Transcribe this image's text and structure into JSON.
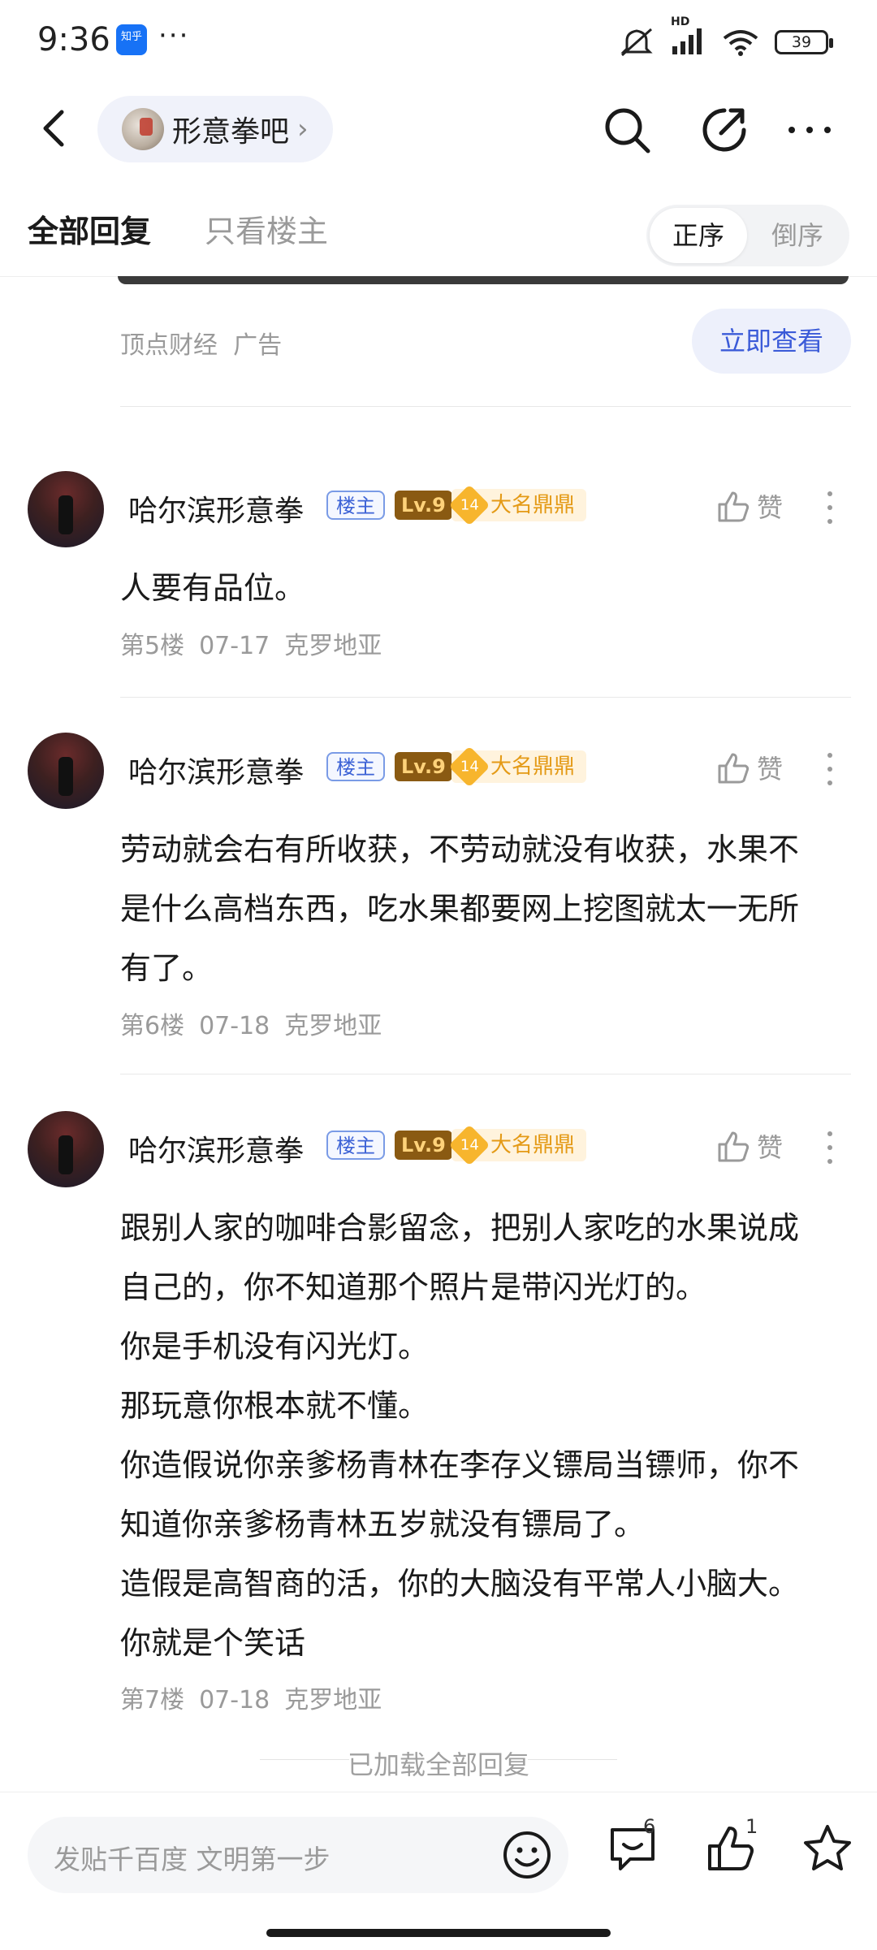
{
  "status": {
    "time": "9:36",
    "app_badge": "知乎",
    "more": "···",
    "network": "HD",
    "battery": "39"
  },
  "nav": {
    "forum_name": "形意拳吧"
  },
  "tabs": {
    "all": "全部回复",
    "host_only": "只看楼主",
    "sort_asc": "正序",
    "sort_desc": "倒序"
  },
  "ad": {
    "source": "顶点财经  广告",
    "cta": "立即查看"
  },
  "posts": [
    {
      "username": "哈尔滨形意拳",
      "host_tag": "楼主",
      "level": "Lv.9",
      "title_level": "14",
      "title": "大名鼎鼎",
      "like_label": "赞",
      "lines": [
        "人要有品位。"
      ],
      "floor": "第5楼",
      "date": "07-17",
      "location": "克罗地亚"
    },
    {
      "username": "哈尔滨形意拳",
      "host_tag": "楼主",
      "level": "Lv.9",
      "title_level": "14",
      "title": "大名鼎鼎",
      "like_label": "赞",
      "lines": [
        "劳动就会右有所收获，不劳动就没有收获，水果不",
        "是什么高档东西，吃水果都要网上挖图就太一无所",
        "有了。"
      ],
      "floor": "第6楼",
      "date": "07-18",
      "location": "克罗地亚"
    },
    {
      "username": "哈尔滨形意拳",
      "host_tag": "楼主",
      "level": "Lv.9",
      "title_level": "14",
      "title": "大名鼎鼎",
      "like_label": "赞",
      "lines": [
        "跟别人家的咖啡合影留念，把别人家吃的水果说成",
        "自己的，你不知道那个照片是带闪光灯的。",
        "你是手机没有闪光灯。",
        "那玩意你根本就不懂。",
        "你造假说你亲爹杨青林在李存义镖局当镖师，你不",
        "知道你亲爹杨青林五岁就没有镖局了。",
        "造假是高智商的活，你的大脑没有平常人小脑大。",
        "你就是个笑话"
      ],
      "floor": "第7楼",
      "date": "07-18",
      "location": "克罗地亚"
    }
  ],
  "footer": {
    "loaded_all": "已加载全部回复",
    "input_placeholder": "发贴千百度 文明第一步",
    "comment_count": "6",
    "like_count": "1"
  },
  "colors": {
    "accent_blue": "#3b5bd8",
    "title_gold": "#e49a16",
    "muted_gray": "#9a9a9a"
  }
}
